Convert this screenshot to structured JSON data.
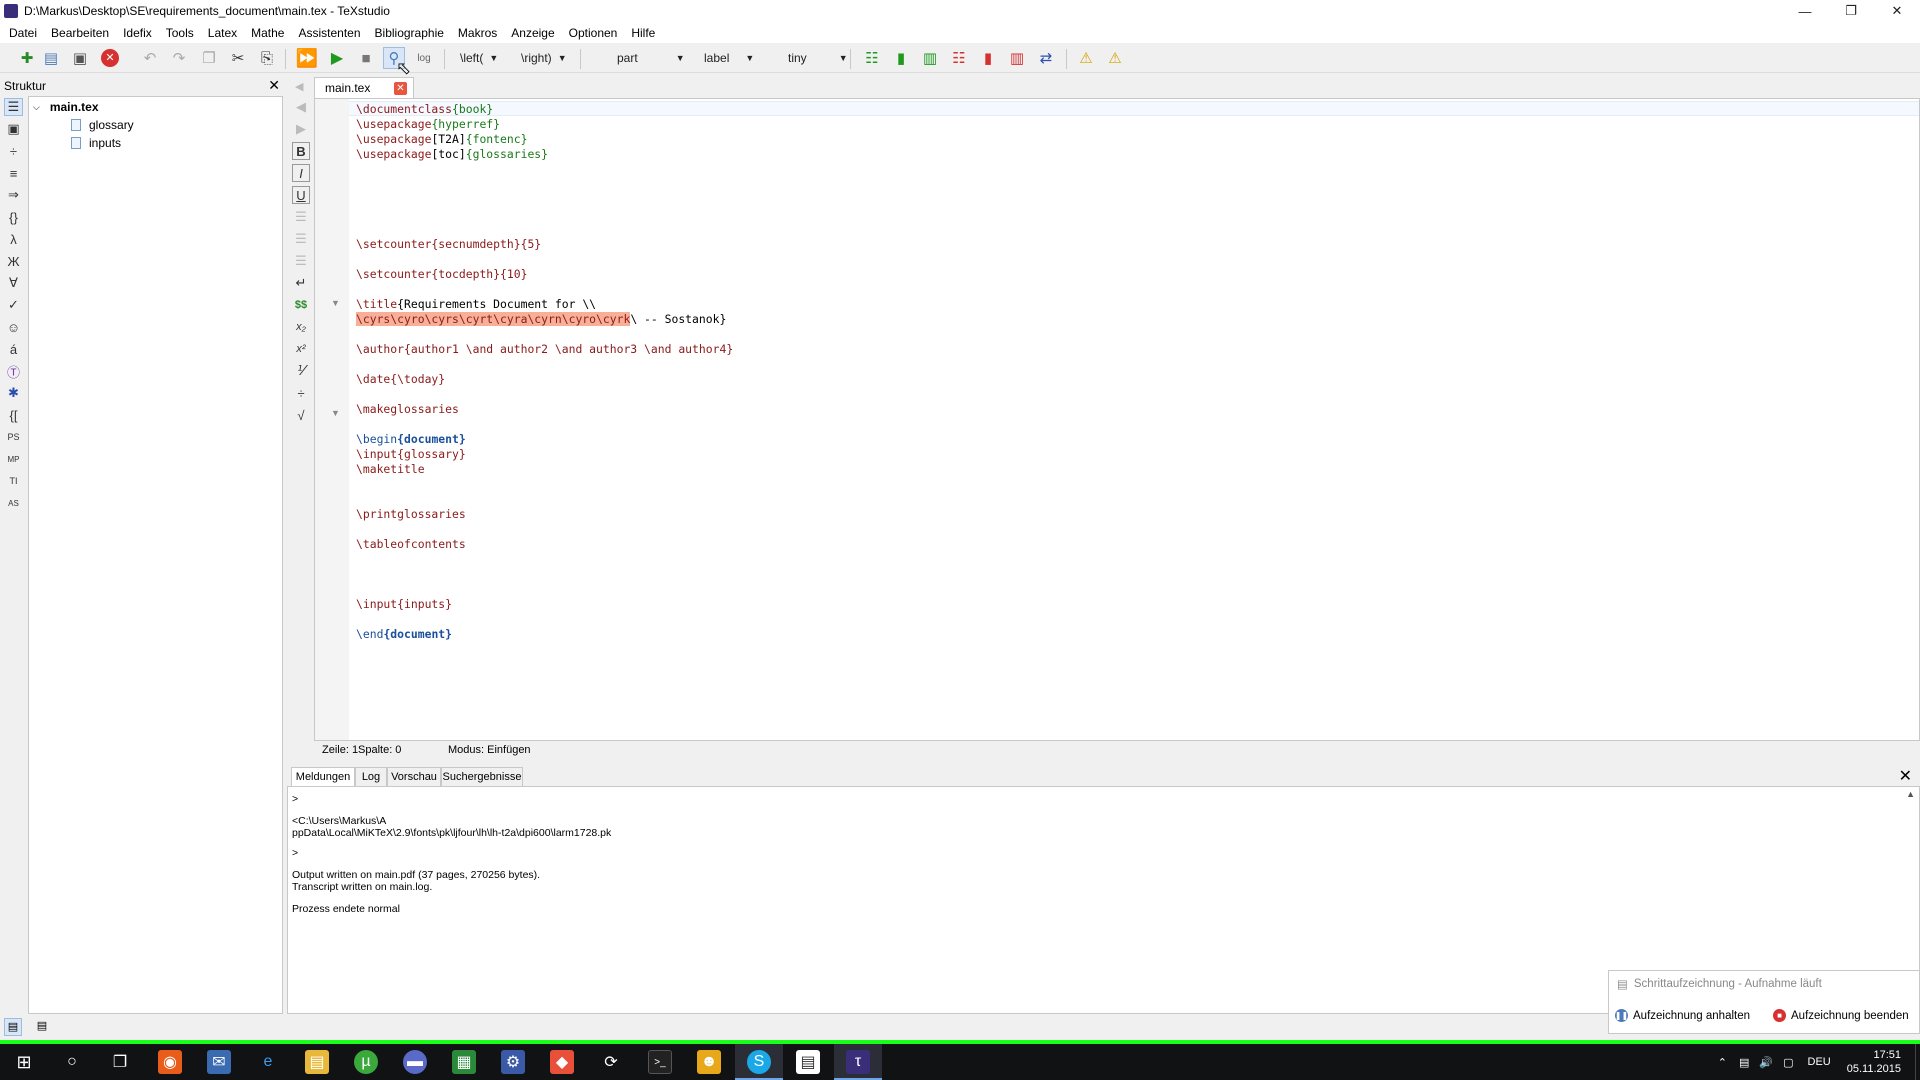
{
  "window": {
    "title": "D:\\Markus\\Desktop\\SE\\requirements_document\\main.tex - TeXstudio"
  },
  "menu": [
    "Datei",
    "Bearbeiten",
    "Idefix",
    "Tools",
    "Latex",
    "Mathe",
    "Assistenten",
    "Bibliographie",
    "Makros",
    "Anzeige",
    "Optionen",
    "Hilfe"
  ],
  "toolbar": {
    "left_label": "\\left(",
    "right_label": "\\right)",
    "part_label": "part",
    "label_label": "label",
    "size_label": "tiny"
  },
  "structure": {
    "title": "Struktur",
    "root": "main.tex",
    "children": [
      "glossary",
      "inputs"
    ]
  },
  "editor": {
    "tab_name": "main.tex",
    "lines": {
      "l1_cmd": "\\documentclass",
      "l1_arg": "{book}",
      "l2_cmd": "\\usepackage",
      "l2_arg": "{hyperref}",
      "l3_cmd": "\\usepackage",
      "l3_opt": "[T2A]",
      "l3_arg": "{fontenc}",
      "l4_cmd": "\\usepackage",
      "l4_opt": "[toc]",
      "l4_arg": "{glossaries}",
      "l5": "\\setcounter{secnumdepth}{5}",
      "l6": "\\setcounter{tocdepth}{10}",
      "l7_cmd": "\\title",
      "l7_txt": "{Requirements Document for \\\\",
      "l8_hl": "\\cyrs\\cyro\\cyrs\\cyrt\\cyra\\cyrn\\cyro\\cyrk",
      "l8_txt": "\\ -- Sostanok}",
      "l9": "\\author{author1 \\and author2 \\and author3 \\and author4}",
      "l10": "\\date{\\today}",
      "l11": "\\makeglossaries",
      "l12_cmd": "\\begin",
      "l12_env": "{document}",
      "l13": "\\input{glossary}",
      "l14": "\\maketitle",
      "l15": "\\printglossaries",
      "l16": "\\tableofcontents",
      "l17": "\\input{inputs}",
      "l18_cmd": "\\end",
      "l18_env": "{document}"
    },
    "status": {
      "line": "Zeile: 1",
      "col": "Spalte: 0",
      "mode": "Modus: Einfügen"
    }
  },
  "messages": {
    "tabs": [
      "Meldungen",
      "Log",
      "Vorschau",
      "Suchergebnisse"
    ],
    "lines": [
      ">",
      "<C:\\Users\\Markus\\A",
      "ppData\\Local\\MiKTeX\\2.9\\fonts\\pk\\ljfour\\lh\\lh-t2a\\dpi600\\larm1728.pk",
      ">",
      "Output written on main.pdf (37 pages, 270256 bytes).",
      "Transcript written on main.log.",
      "Prozess endete normal"
    ]
  },
  "notification": {
    "title": "Schrittaufzeichnung - Aufnahme läuft",
    "pause": "Aufzeichnung anhalten",
    "stop": "Aufzeichnung beenden"
  },
  "tray": {
    "lang": "DEU",
    "time": "17:51",
    "date": "05.11.2015"
  },
  "colors": {
    "command": "#8b1a1a",
    "argument": "#1a7a1a",
    "environment": "#1a4f9c",
    "highlight": "#f7b097",
    "green_strip": "#1aff1a"
  }
}
